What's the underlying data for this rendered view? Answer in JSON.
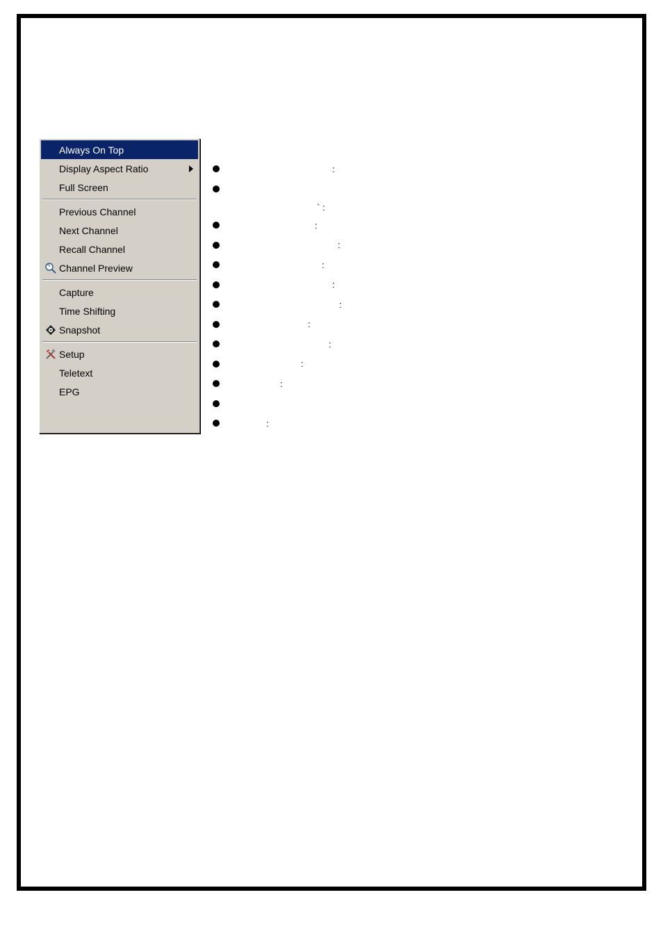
{
  "menu": {
    "items": [
      {
        "label": "Always On Top",
        "highlight": true,
        "icon": null,
        "submenu": false
      },
      {
        "label": "Display Aspect Ratio",
        "highlight": false,
        "icon": null,
        "submenu": true
      },
      {
        "label": "Full Screen",
        "highlight": false,
        "icon": null,
        "submenu": false
      },
      {
        "sep": true
      },
      {
        "label": "Previous Channel",
        "highlight": false,
        "icon": null,
        "submenu": false
      },
      {
        "label": "Next Channel",
        "highlight": false,
        "icon": null,
        "submenu": false
      },
      {
        "label": "Recall Channel",
        "highlight": false,
        "icon": null,
        "submenu": false
      },
      {
        "label": "Channel Preview",
        "highlight": false,
        "icon": "magnifier",
        "submenu": false
      },
      {
        "sep": true
      },
      {
        "label": "Capture",
        "highlight": false,
        "icon": null,
        "submenu": false
      },
      {
        "label": "Time Shifting",
        "highlight": false,
        "icon": null,
        "submenu": false
      },
      {
        "label": "Snapshot",
        "highlight": false,
        "icon": "snapshot",
        "submenu": false
      },
      {
        "sep": true
      },
      {
        "label": "Setup",
        "highlight": false,
        "icon": "tools",
        "submenu": false
      },
      {
        "label": "Teletext",
        "highlight": false,
        "icon": null,
        "submenu": false
      },
      {
        "label": "EPG",
        "highlight": false,
        "icon": null,
        "submenu": false
      }
    ]
  },
  "descriptions": [
    {
      "spaces": 150,
      "tail": ":"
    },
    {
      "spaces": 0,
      "tail": ""
    },
    {
      "spaces": 148,
      "tail": "`   :",
      "indent": true
    },
    {
      "spaces": 125,
      "tail": ":"
    },
    {
      "spaces": 158,
      "tail": ":"
    },
    {
      "spaces": 135,
      "tail": ":"
    },
    {
      "spaces": 150,
      "tail": ":"
    },
    {
      "spaces": 160,
      "tail": ":"
    },
    {
      "spaces": 115,
      "tail": ":"
    },
    {
      "spaces": 145,
      "tail": ":"
    },
    {
      "spaces": 105,
      "tail": ":"
    },
    {
      "spaces": 75,
      "tail": ":"
    },
    {
      "spaces": 0,
      "tail": ""
    },
    {
      "spaces": 55,
      "tail": ":"
    }
  ]
}
